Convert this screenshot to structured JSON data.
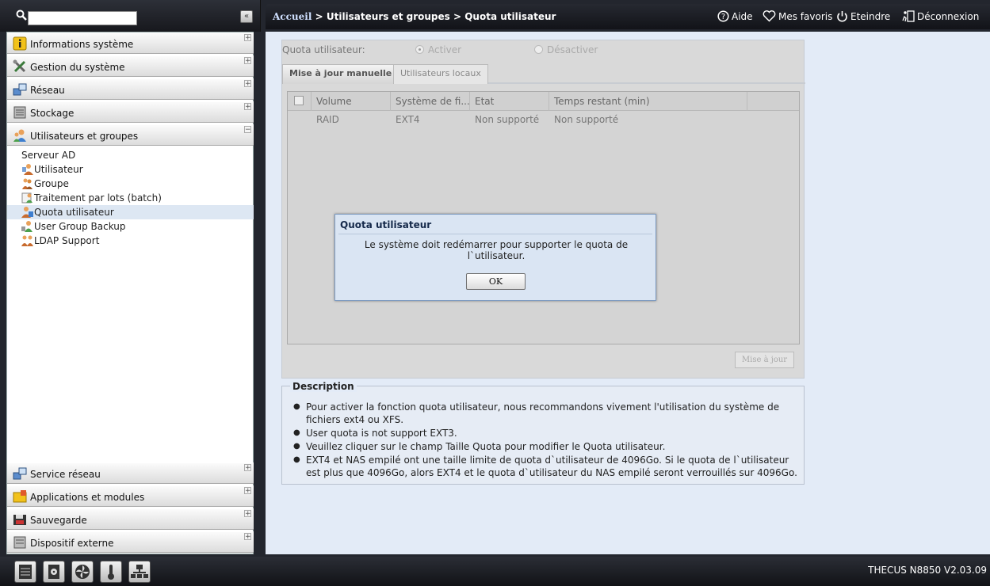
{
  "sidebar": {
    "categories": [
      {
        "label": "Informations système",
        "icon": "info-icon",
        "toggle": "+"
      },
      {
        "label": "Gestion du système",
        "icon": "tools-icon",
        "toggle": "+"
      },
      {
        "label": "Réseau",
        "icon": "network-icon",
        "toggle": "+"
      },
      {
        "label": "Stockage",
        "icon": "storage-icon",
        "toggle": "+"
      },
      {
        "label": "Utilisateurs et groupes",
        "icon": "users-icon",
        "toggle": "−"
      }
    ],
    "subitems": [
      {
        "label": "Serveur AD"
      },
      {
        "label": "Utilisateur",
        "icon": "user-icon"
      },
      {
        "label": "Groupe",
        "icon": "group-icon"
      },
      {
        "label": "Traitement par lots (batch)",
        "icon": "batch-icon"
      },
      {
        "label": "Quota utilisateur",
        "icon": "quota-icon",
        "selected": true
      },
      {
        "label": "User Group Backup",
        "icon": "backup-user-icon"
      },
      {
        "label": "LDAP Support",
        "icon": "ldap-icon"
      }
    ],
    "bottom_categories": [
      {
        "label": "Service réseau",
        "icon": "network-service-icon",
        "toggle": "+"
      },
      {
        "label": "Applications et modules",
        "icon": "modules-icon",
        "toggle": "+"
      },
      {
        "label": "Sauvegarde",
        "icon": "backup-icon",
        "toggle": "+"
      },
      {
        "label": "Dispositif externe",
        "icon": "external-device-icon",
        "toggle": "+"
      }
    ],
    "collapse_label": "«"
  },
  "header": {
    "home": "Accueil",
    "sep1": ">",
    "crumb1": "Utilisateurs et groupes",
    "sep2": ">",
    "crumb2": "Quota utilisateur",
    "help": "Aide",
    "favorites": "Mes favoris",
    "shutdown": "Eteindre",
    "logout": "Déconnexion"
  },
  "quota": {
    "label": "Quota utilisateur:",
    "enable": "Activer",
    "disable": "Désactiver",
    "tabs": [
      "Mise à jour manuelle",
      "Utilisateurs locaux"
    ],
    "columns": [
      "Volume",
      "Système de fi...",
      "Etat",
      "Temps restant (min)"
    ],
    "rows": [
      [
        "RAID",
        "EXT4",
        "Non supporté",
        "Non supporté"
      ]
    ],
    "update_button": "Mise à jour"
  },
  "description": {
    "title": "Description",
    "items": [
      "Pour activer la fonction quota utilisateur, nous recommandons vivement l'utilisation du système de fichiers ext4 ou XFS.",
      "User quota is not support EXT3.",
      "Veuillez cliquer sur le champ Taille Quota pour modifier le Quota utilisateur.",
      "EXT4 et NAS empilé ont une taille limite de quota d`utilisateur de 4096Go. Si le quota de l`utilisateur est plus que 4096Go, alors EXT4 et le quota d`utilisateur du NAS empilé seront verrouillés sur 4096Go."
    ]
  },
  "dialog": {
    "title": "Quota utilisateur",
    "message": "Le système doit redémarrer pour supporter le quota de l`utilisateur.",
    "ok": "OK"
  },
  "footer": {
    "version": "THECUS N8850 V2.03.09",
    "icons": [
      "server-status-icon",
      "disk-icon",
      "fan-icon",
      "temperature-icon",
      "network-topology-icon"
    ]
  }
}
